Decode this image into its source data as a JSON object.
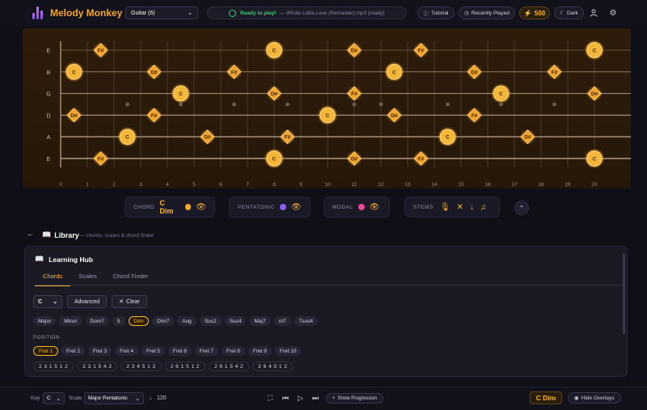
{
  "header": {
    "brand": "Melody Monkey",
    "instrument": "Guitar (6)",
    "status_ready": "Ready to play!",
    "status_track": "— Whole Lotta Love (Remaster).mp3 (ready)",
    "tutorial": "Tutorial",
    "recently_played": "Recently Played",
    "points": "500",
    "theme": "Dark"
  },
  "fretboard": {
    "strings": [
      "E",
      "B",
      "G",
      "D",
      "A",
      "E"
    ],
    "fret_numbers": [
      "0",
      "1",
      "2",
      "3",
      "4",
      "5",
      "6",
      "7",
      "8",
      "9",
      "10",
      "11",
      "12",
      "13",
      "14",
      "15",
      "16",
      "17",
      "18",
      "19",
      "20"
    ],
    "notes": [
      {
        "string": 0,
        "fret": 1.5,
        "label": "F#",
        "shape": "diamond"
      },
      {
        "string": 0,
        "fret": 8,
        "label": "C",
        "shape": "circle"
      },
      {
        "string": 0,
        "fret": 11,
        "label": "D#",
        "shape": "diamond"
      },
      {
        "string": 0,
        "fret": 13.5,
        "label": "F#",
        "shape": "diamond"
      },
      {
        "string": 0,
        "fret": 20,
        "label": "C",
        "shape": "circle"
      },
      {
        "string": 1,
        "fret": 0.5,
        "label": "C",
        "shape": "circle"
      },
      {
        "string": 1,
        "fret": 3.5,
        "label": "D#",
        "shape": "diamond"
      },
      {
        "string": 1,
        "fret": 6.5,
        "label": "F#",
        "shape": "diamond"
      },
      {
        "string": 1,
        "fret": 12.5,
        "label": "C",
        "shape": "circle"
      },
      {
        "string": 1,
        "fret": 15.5,
        "label": "D#",
        "shape": "diamond"
      },
      {
        "string": 1,
        "fret": 18.5,
        "label": "F#",
        "shape": "diamond"
      },
      {
        "string": 2,
        "fret": 4.5,
        "label": "C",
        "shape": "circle"
      },
      {
        "string": 2,
        "fret": 8,
        "label": "D#",
        "shape": "diamond"
      },
      {
        "string": 2,
        "fret": 11,
        "label": "F#",
        "shape": "diamond"
      },
      {
        "string": 2,
        "fret": 16.5,
        "label": "C",
        "shape": "circle"
      },
      {
        "string": 2,
        "fret": 20,
        "label": "D#",
        "shape": "diamond"
      },
      {
        "string": 3,
        "fret": 0.5,
        "label": "D#",
        "shape": "diamond"
      },
      {
        "string": 3,
        "fret": 3.5,
        "label": "F#",
        "shape": "diamond"
      },
      {
        "string": 3,
        "fret": 10,
        "label": "C",
        "shape": "circle"
      },
      {
        "string": 3,
        "fret": 12.5,
        "label": "D#",
        "shape": "diamond"
      },
      {
        "string": 3,
        "fret": 15.5,
        "label": "F#",
        "shape": "diamond"
      },
      {
        "string": 4,
        "fret": 2.5,
        "label": "C",
        "shape": "circle"
      },
      {
        "string": 4,
        "fret": 5.5,
        "label": "D#",
        "shape": "diamond"
      },
      {
        "string": 4,
        "fret": 8.5,
        "label": "F#",
        "shape": "diamond"
      },
      {
        "string": 4,
        "fret": 14.5,
        "label": "C",
        "shape": "circle"
      },
      {
        "string": 4,
        "fret": 17.5,
        "label": "D#",
        "shape": "diamond"
      },
      {
        "string": 5,
        "fret": 1.5,
        "label": "F#",
        "shape": "diamond"
      },
      {
        "string": 5,
        "fret": 8,
        "label": "C",
        "shape": "circle"
      },
      {
        "string": 5,
        "fret": 11,
        "label": "D#",
        "shape": "diamond"
      },
      {
        "string": 5,
        "fret": 13.5,
        "label": "F#",
        "shape": "diamond"
      },
      {
        "string": 5,
        "fret": 20,
        "label": "C",
        "shape": "circle"
      }
    ]
  },
  "overlays": {
    "chord_label": "CHORD",
    "chord_value": "C Dim",
    "chord_color": "#f5a623",
    "pentatonic_label": "PENTATONIC",
    "pentatonic_color": "#8b5cf6",
    "modal_label": "MODAL",
    "modal_color": "#ec4899",
    "stems_label": "STEMS"
  },
  "library": {
    "title": "Library",
    "subtitle": "— chords, scales & chord finder",
    "hub_title": "Learning Hub",
    "tabs": [
      "Chords",
      "Scales",
      "Chord Finder"
    ],
    "root": "C",
    "advanced": "Advanced",
    "clear": "Clear",
    "chord_types": [
      "Major",
      "Minor",
      "Dom7",
      "5",
      "Dim",
      "Dim7",
      "Aug",
      "Sus2",
      "Sus4",
      "Maj7",
      "m7",
      "7sus4"
    ],
    "active_chord_type": "Dim",
    "position_label": "POSITION",
    "positions": [
      "Fret 1",
      "Fret 2",
      "Fret 3",
      "Fret 4",
      "Fret 5",
      "Fret 6",
      "Fret 7",
      "Fret 8",
      "Fret 9",
      "Fret 10"
    ],
    "fingerings": [
      "2 3 1 5 1 2",
      "2 3 1 5 4 2",
      "2 3 4 5 1 2",
      "2 6 1 5 1 2",
      "2 6 1 5 4 2",
      "2 6 4 5 1 2"
    ]
  },
  "bottom": {
    "key_label": "Key",
    "key": "C",
    "scale_label": "Scale",
    "scale": "Major Pentatonic",
    "tempo": "♩ 120",
    "show_progression": "Show Progression",
    "chord": "C Dim",
    "hide_overlays": "Hide Overlays"
  }
}
